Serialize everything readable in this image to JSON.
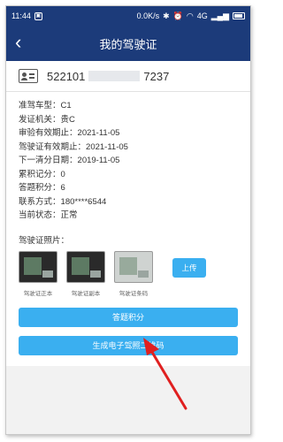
{
  "status_bar": {
    "time": "11:44",
    "network_speed": "0.0K/s",
    "signal": "4G"
  },
  "nav": {
    "title": "我的驾驶证"
  },
  "license": {
    "number_prefix": "522101",
    "number_suffix": "7237"
  },
  "info": [
    {
      "key": "准驾车型",
      "value": "C1"
    },
    {
      "key": "发证机关",
      "value": "贵C"
    },
    {
      "key": "审验有效期止",
      "value": "2021-11-05"
    },
    {
      "key": "驾驶证有效期止",
      "value": "2021-11-05"
    },
    {
      "key": "下一清分日期",
      "value": "2019-11-05"
    },
    {
      "key": "累积记分",
      "value": "0"
    },
    {
      "key": "答题积分",
      "value": "6"
    },
    {
      "key": "联系方式",
      "value": "180****6544"
    },
    {
      "key": "当前状态",
      "value": "正常"
    }
  ],
  "photos": {
    "label": "驾驶证照片：",
    "items": [
      {
        "caption": "驾驶证正本"
      },
      {
        "caption": "驾驶证副本"
      },
      {
        "caption": "驾驶证条码"
      }
    ],
    "upload_label": "上传"
  },
  "buttons": {
    "quiz_points": "答题积分",
    "generate_qr": "生成电子驾照二维码"
  },
  "colors": {
    "header": "#1c3b7a",
    "button": "#3aaff0",
    "annotation_arrow": "#e02020"
  }
}
